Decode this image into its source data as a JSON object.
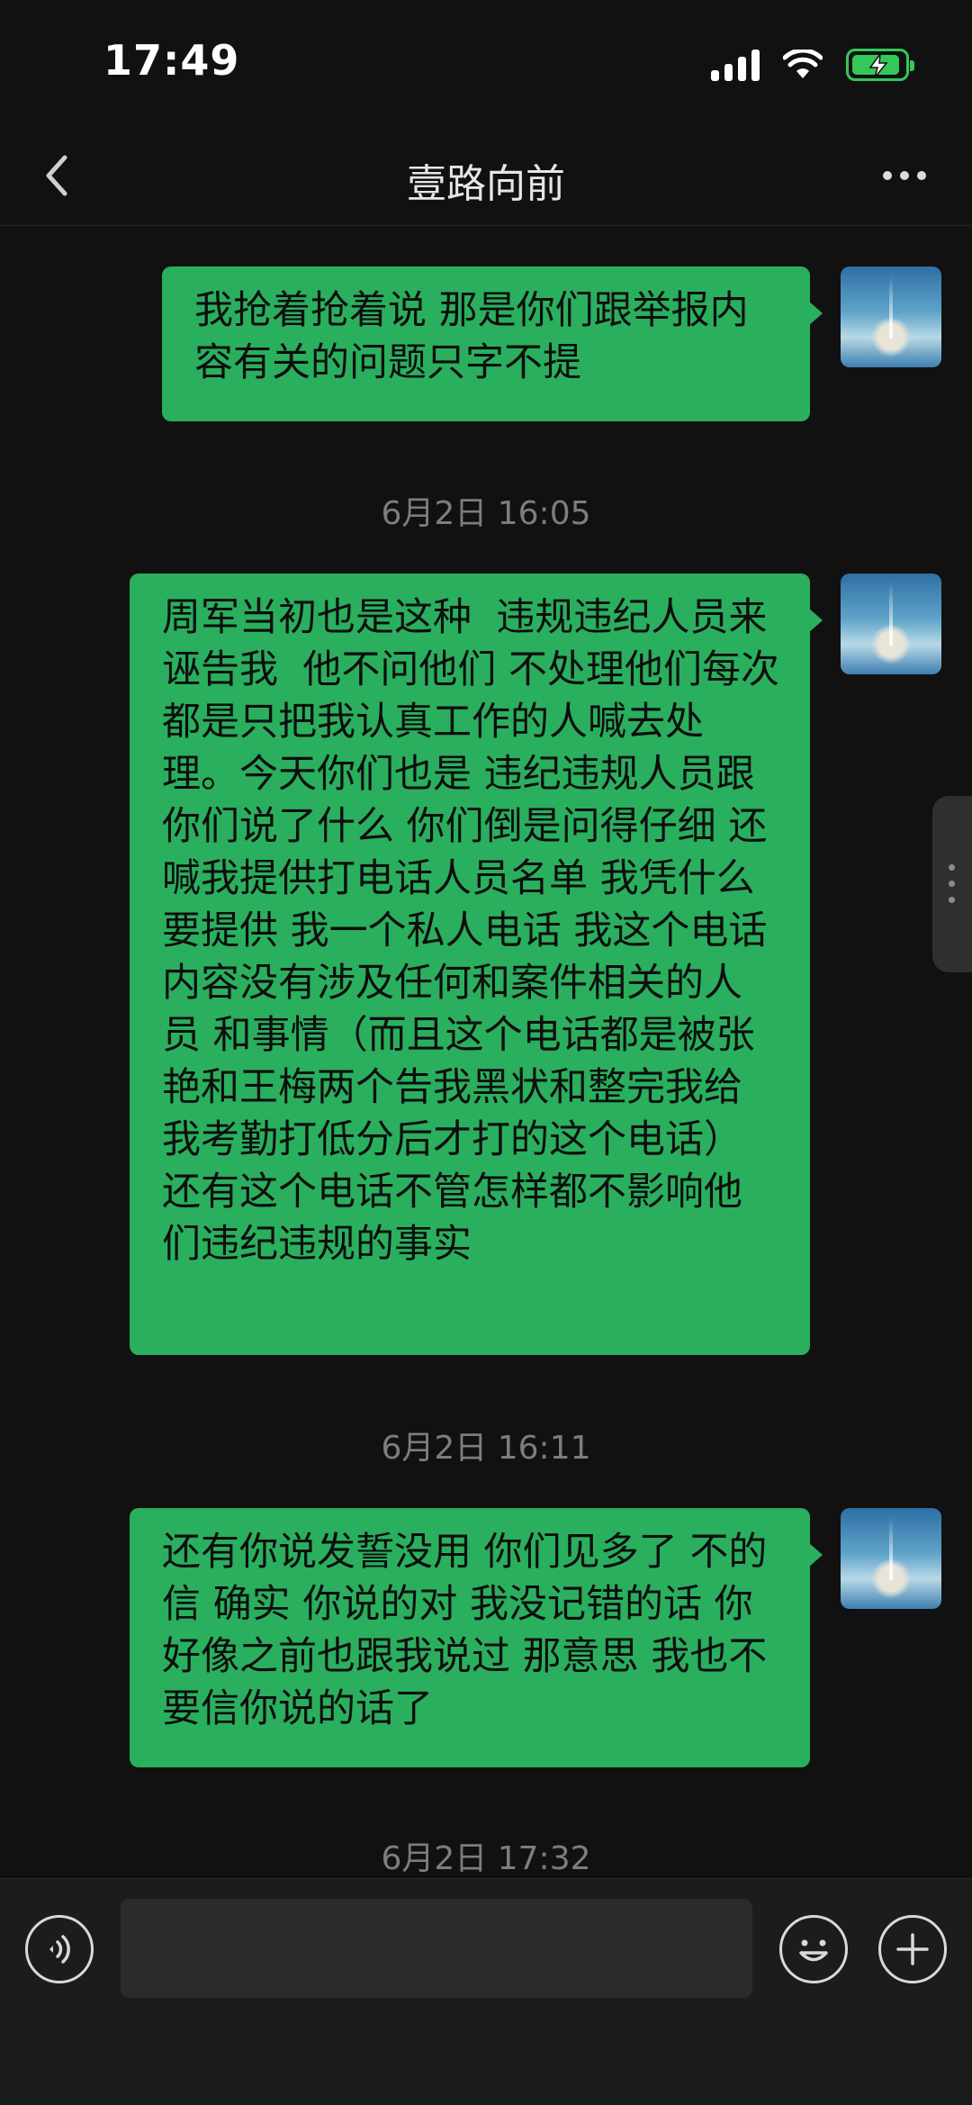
{
  "status_bar": {
    "time": "17:49"
  },
  "nav": {
    "title": "壹路向前"
  },
  "messages": [
    {
      "text": "我抢着抢着说 那是你们跟举报内容有关的问题只字不提"
    },
    {
      "timestamp": "6月2日 16:05"
    },
    {
      "text": "周军当初也是这种  违规违纪人员来诬告我  他不问他们 不处理他们每次都是只把我认真工作的人喊去处理。今天你们也是 违纪违规人员跟你们说了什么 你们倒是问得仔细 还喊我提供打电话人员名单 我凭什么要提供 我一个私人电话 我这个电话内容没有涉及任何和案件相关的人员 和事情（而且这个电话都是被张艳和王梅两个告我黑状和整完我给我考勤打低分后才打的这个电话）还有这个电话不管怎样都不影响他们违纪违规的事实"
    },
    {
      "timestamp": "6月2日 16:11"
    },
    {
      "text": "还有你说发誓没用 你们见多了 不的信 确实 你说的对 我没记错的话 你好像之前也跟我说过 那意思 我也不要信你说的话了"
    },
    {
      "timestamp": "6月2日 17:32"
    }
  ],
  "input": {
    "value": "",
    "placeholder": ""
  },
  "icons": {
    "back": "chevron-left-icon",
    "more": "more-dots-icon",
    "voice": "voice-icon",
    "emoji": "emoji-icon",
    "plus": "plus-icon",
    "signal": "signal-icon",
    "wifi": "wifi-icon",
    "battery": "battery-charging-icon"
  },
  "colors": {
    "bubble": "#2aaf5e",
    "background": "#111111",
    "battery": "#34c759"
  }
}
